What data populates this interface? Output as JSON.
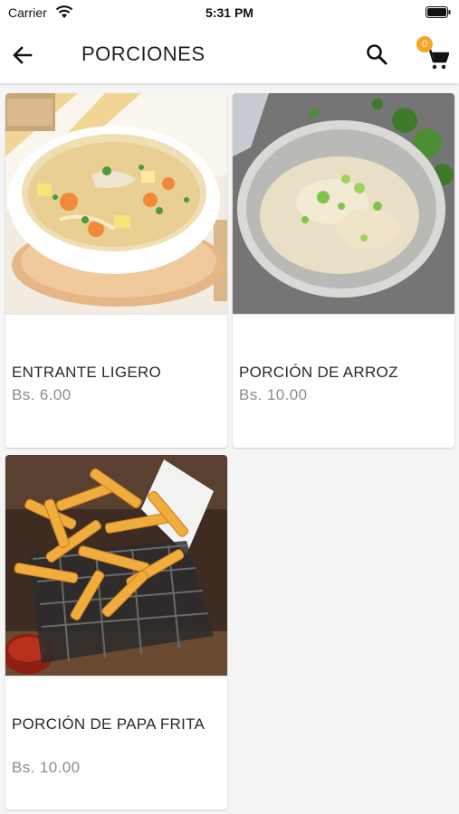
{
  "status_bar": {
    "carrier": "Carrier",
    "time": "5:31 PM",
    "wifi_icon": "wifi-icon",
    "battery_icon": "battery-icon"
  },
  "app_bar": {
    "title": "PORCIONES",
    "back_icon": "arrow-left-icon",
    "search_icon": "search-icon",
    "cart_icon": "shopping-cart-icon",
    "cart_count": "0",
    "badge_color": "#f5a623"
  },
  "products": [
    {
      "name": "ENTRANTE LIGERO",
      "price": "Bs. 6.00",
      "image": "chicken-noodle-soup-bowl"
    },
    {
      "name": "PORCIÓN DE ARROZ",
      "price": "Bs. 10.00",
      "image": "risotto-bowl-with-green-onion"
    },
    {
      "name": "PORCIÓN DE PAPA FRITA",
      "price": "Bs. 10.00",
      "image": "french-fries-in-wire-basket"
    }
  ],
  "colors": {
    "background": "#f5f5f5",
    "card": "#ffffff",
    "price_text": "#8c8c8c"
  }
}
